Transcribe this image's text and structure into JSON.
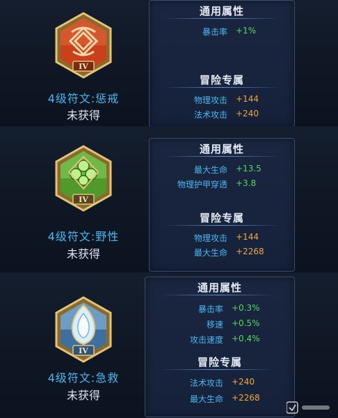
{
  "cards": [
    {
      "rune_name": "4级符文:惩戒",
      "status": "未获得",
      "emblem_numeral": "IV",
      "emblem_color": "#c8401c",
      "common_title": "通用属性",
      "adventure_title": "冒险专属",
      "common_stats": [
        {
          "label": "暴击率",
          "value": "+1%"
        }
      ],
      "adventure_stats": [
        {
          "label": "物理攻击",
          "value": "+144"
        },
        {
          "label": "法术攻击",
          "value": "+240"
        }
      ]
    },
    {
      "rune_name": "4级符文:野性",
      "status": "未获得",
      "emblem_numeral": "IV",
      "emblem_color": "#6fbf3a",
      "common_title": "通用属性",
      "adventure_title": "冒险专属",
      "common_stats": [
        {
          "label": "最大生命",
          "value": "+13.5"
        },
        {
          "label": "物理护甲穿透",
          "value": "+3.8"
        }
      ],
      "adventure_stats": [
        {
          "label": "物理攻击",
          "value": "+144"
        },
        {
          "label": "最大生命",
          "value": "+2268"
        }
      ]
    },
    {
      "rune_name": "4级符文:急救",
      "status": "未获得",
      "emblem_numeral": "IV",
      "emblem_color": "#5a8fc8",
      "common_title": "通用属性",
      "adventure_title": "冒险专属",
      "common_stats": [
        {
          "label": "暴击率",
          "value": "+0.3%"
        },
        {
          "label": "移速",
          "value": "+0.5%"
        },
        {
          "label": "攻击速度",
          "value": "+0.4%"
        }
      ],
      "adventure_stats": [
        {
          "label": "法术攻击",
          "value": "+240"
        },
        {
          "label": "最大生命",
          "value": "+2268"
        }
      ]
    }
  ],
  "colors": {
    "label_blue": "#4ab8f0",
    "common_value": "#57d85f",
    "adventure_value": "#f0a93a"
  }
}
